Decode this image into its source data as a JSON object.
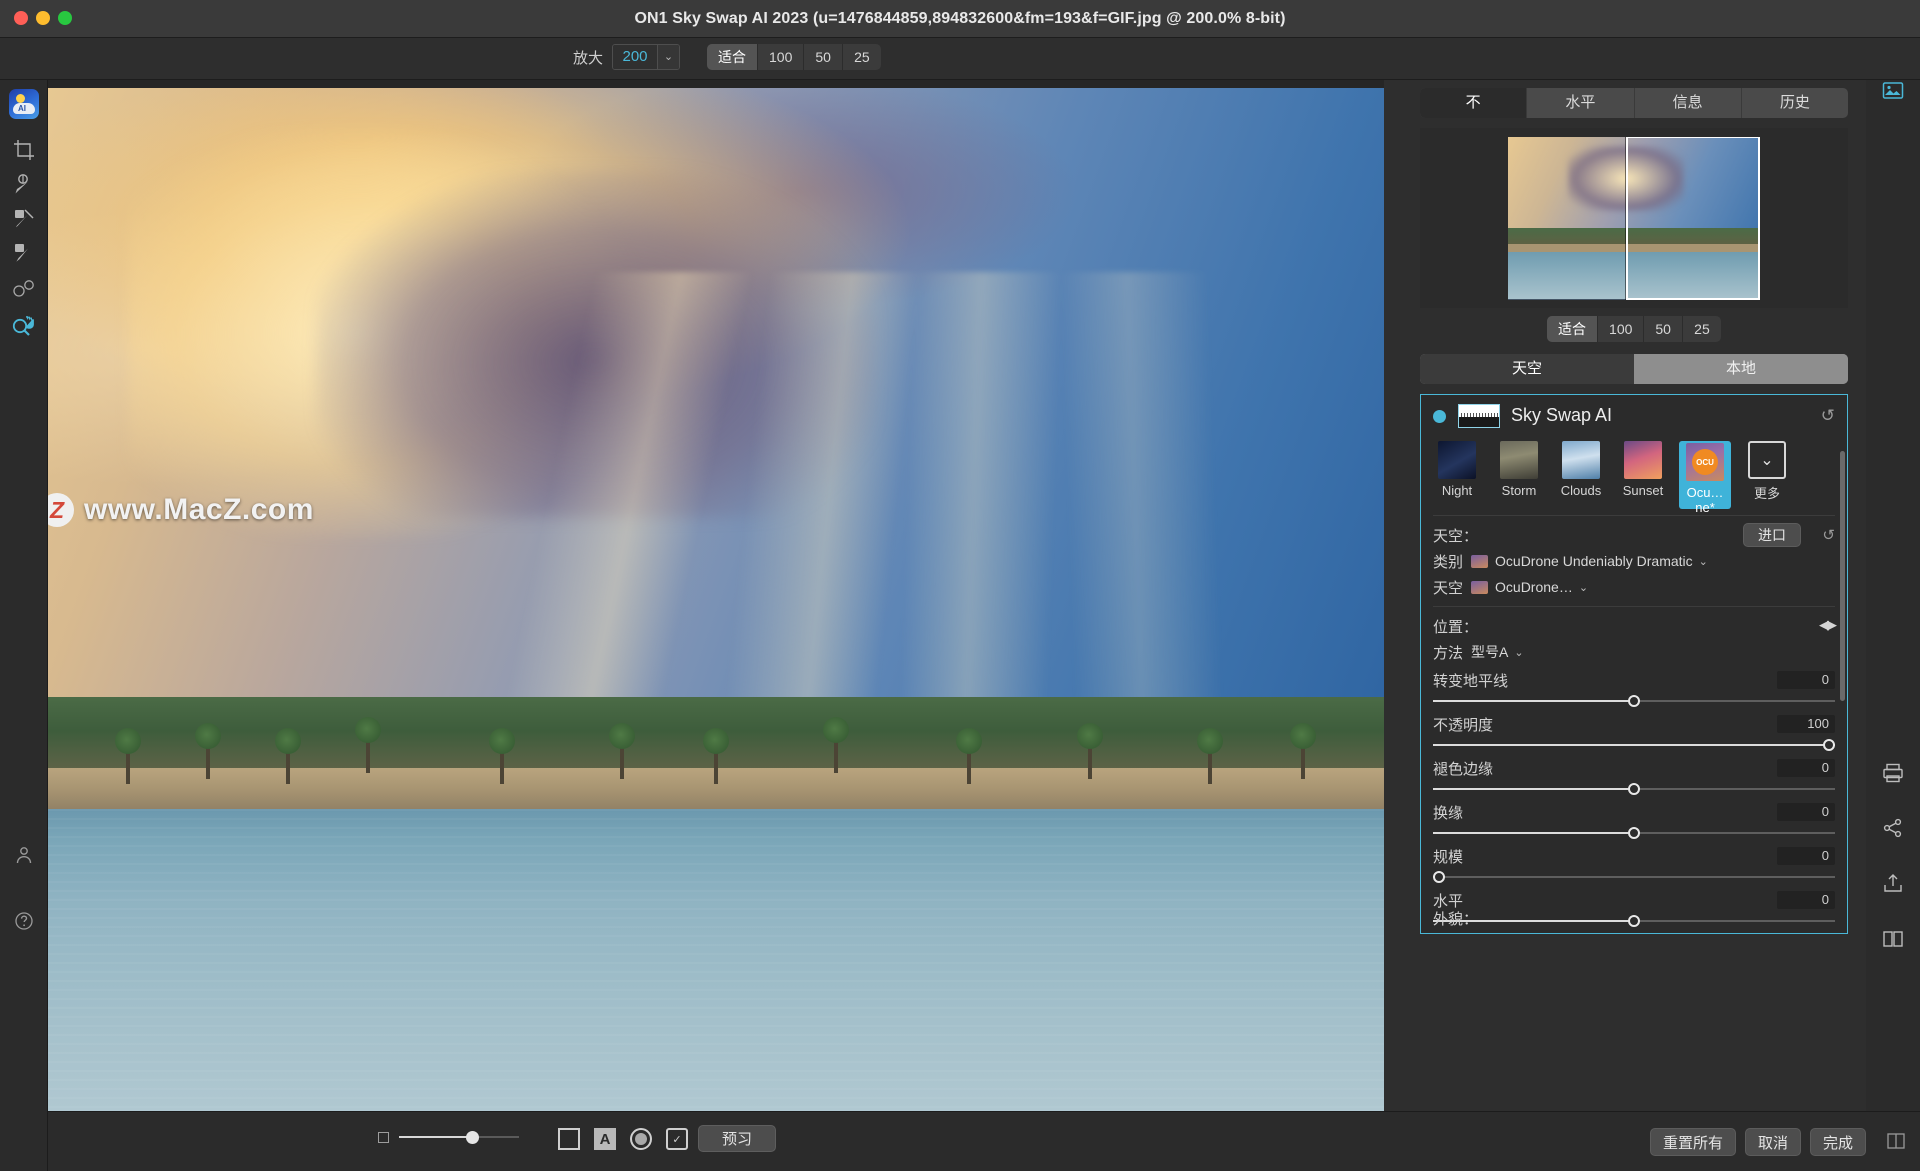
{
  "window": {
    "title": "ON1 Sky Swap AI 2023 (u=1476844859,894832600&fm=193&f=GIF.jpg @ 200.0% 8-bit)",
    "traffic": [
      "close-button",
      "minimize-button",
      "maximize-button"
    ]
  },
  "toolbar": {
    "zoom_label": "放大",
    "zoom_value": "200",
    "zoom_caret": "⌄",
    "fit_buttons": [
      {
        "label": "适合",
        "active": true
      },
      {
        "label": "100",
        "active": false
      },
      {
        "label": "50",
        "active": false
      },
      {
        "label": "25",
        "active": false
      }
    ]
  },
  "left_rail": {
    "app_logo": "on1-sky-swap-app-icon",
    "tools": [
      {
        "name": "crop-tool",
        "icon": "crop-icon"
      },
      {
        "name": "perfect-brush-tool",
        "icon": "brush-mask-icon"
      },
      {
        "name": "retouch-brush-tool",
        "icon": "retouch-brush-icon"
      },
      {
        "name": "healing-brush-tool",
        "icon": "healing-brush-icon"
      },
      {
        "name": "chisel-blur-tool",
        "icon": "blur-circles-icon"
      },
      {
        "name": "zoom-pan-tool",
        "icon": "zoom-hand-icon"
      }
    ],
    "bottom_tools": [
      {
        "name": "people-tool",
        "icon": "person-icon"
      },
      {
        "name": "help-tool",
        "icon": "question-circle-icon"
      }
    ]
  },
  "canvas": {
    "watermark": {
      "badge": "Z",
      "text": "www.MacZ.com"
    }
  },
  "canvas_bar": {
    "opacity_icon": "square-outline-icon",
    "opacity_value": 56,
    "icons": [
      {
        "name": "show-mask-square-icon",
        "glyph": ""
      },
      {
        "name": "text-overlay-icon",
        "glyph": "A"
      },
      {
        "name": "mask-circle-icon",
        "glyph": ""
      },
      {
        "name": "checkbox-mask-icon",
        "glyph": "✓"
      }
    ],
    "preview_label": "预习"
  },
  "right_panel": {
    "tabs": [
      {
        "label": "不",
        "active": true
      },
      {
        "label": "水平",
        "active": false
      },
      {
        "label": "信息",
        "active": false
      },
      {
        "label": "历史",
        "active": false
      }
    ],
    "navigator_zoom": [
      {
        "label": "适合",
        "active": true
      },
      {
        "label": "100",
        "active": false
      },
      {
        "label": "50",
        "active": false
      },
      {
        "label": "25",
        "active": false
      }
    ],
    "mode_tabs": [
      {
        "label": "天空",
        "active": true
      },
      {
        "label": "本地",
        "active": false
      }
    ],
    "module": {
      "title": "Sky Swap AI",
      "enabled": true,
      "reset_icon": "reset-arrow-icon",
      "presets": [
        {
          "label": "Night",
          "thumb": "night",
          "selected": false
        },
        {
          "label": "Storm",
          "thumb": "storm",
          "selected": false
        },
        {
          "label": "Clouds",
          "thumb": "clouds",
          "selected": false
        },
        {
          "label": "Sunset",
          "thumb": "sunset",
          "selected": false
        },
        {
          "label": "Ocu…ne*",
          "thumb": "ocu",
          "selected": true
        },
        {
          "label": "更多",
          "thumb": "more",
          "selected": false
        }
      ],
      "sky_section_label": "天空：",
      "import_label": "进口",
      "category_label": "类别",
      "category_value": "OcuDrone Undeniably Dramatic",
      "sky_label": "天空",
      "sky_value": "OcuDrone…",
      "position_label": "位置：",
      "method_label": "方法",
      "method_value": "型号A",
      "sliders": [
        {
          "label": "转变地平线",
          "value": "0",
          "pct": 50
        },
        {
          "label": "不透明度",
          "value": "100",
          "pct": 100
        },
        {
          "label": "褪色边缘",
          "value": "0",
          "pct": 50
        },
        {
          "label": "换缘",
          "value": "0",
          "pct": 50
        },
        {
          "label": "规模",
          "value": "0",
          "pct": 0
        },
        {
          "label": "水平",
          "value": "0",
          "pct": 50
        }
      ],
      "appearance_label": "外貌："
    }
  },
  "edge_rail": {
    "icons": [
      {
        "name": "layers-photo-icon",
        "glyph": "▤",
        "accent": true
      },
      {
        "name": "print-icon",
        "glyph": "🖶",
        "accent": false
      },
      {
        "name": "share-icon",
        "glyph": "⤳",
        "accent": false
      },
      {
        "name": "export-icon",
        "glyph": "⇪",
        "accent": false
      },
      {
        "name": "compare-split-icon",
        "glyph": "◫",
        "accent": false
      }
    ]
  },
  "footer": {
    "buttons": [
      {
        "label": "重置所有",
        "name": "reset-all-button"
      },
      {
        "label": "取消",
        "name": "cancel-button"
      },
      {
        "label": "完成",
        "name": "done-button"
      }
    ],
    "divider_icon": "panel-divider-icon"
  }
}
